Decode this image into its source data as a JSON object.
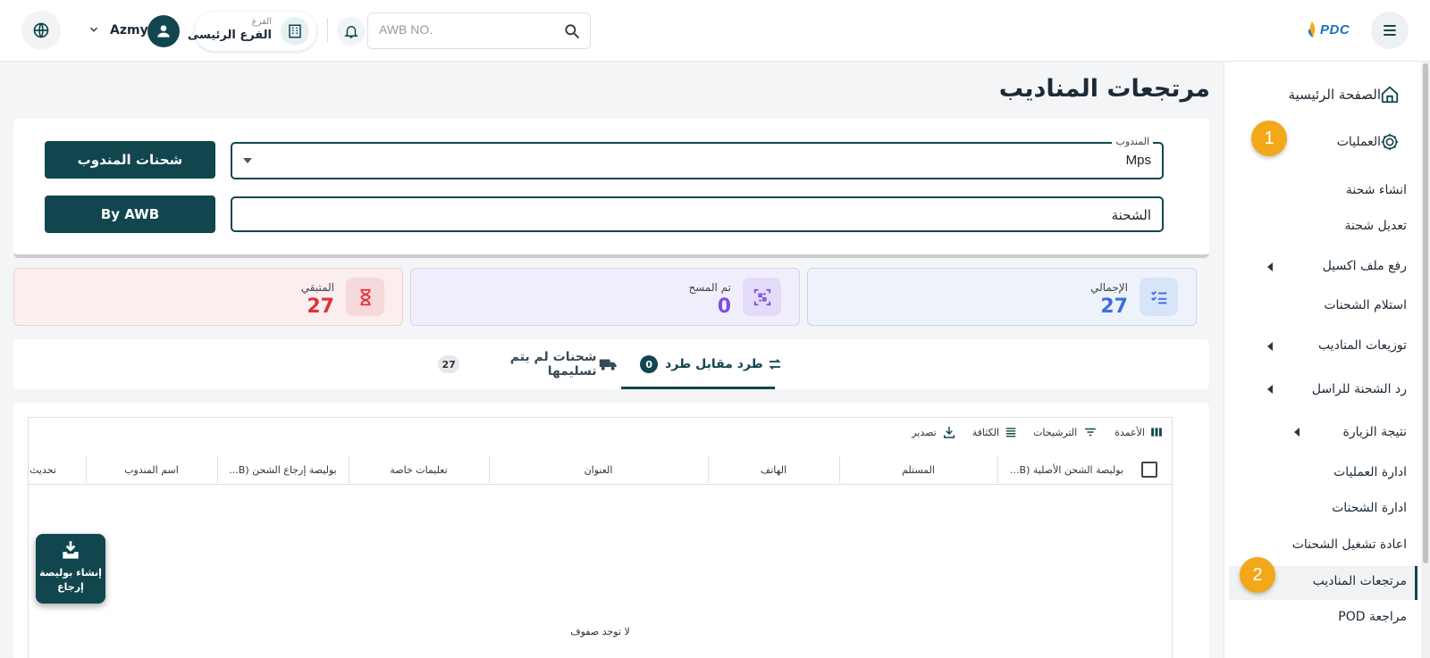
{
  "header": {
    "user_name": "Azmy",
    "branch_small": "الفرع",
    "branch_name": "الفرع الرئيسى",
    "awb_placeholder": "AWB NO.",
    "logo_text": "PDC"
  },
  "sidebar": {
    "home": "الصفحة الرئيسية",
    "operations": "العمليات",
    "items": [
      "انشاء شحنة",
      "تعديل شحنة",
      "رفع ملف اكسيل",
      "استلام الشحنات",
      "توزيعات المناديب",
      "رد الشحنة للراسل",
      "نتيجة الزيارة",
      "ادارة العمليات",
      "ادارة الشحنات",
      "اعادة تشغيل الشحنات",
      "مرتجعات المناديب",
      "مراجعة POD"
    ],
    "badge1": "1",
    "badge2": "2"
  },
  "page": {
    "title": "مرتجعات المناديب"
  },
  "filter": {
    "rep_label": "المندوب",
    "rep_value": "Mps",
    "shipment_value": "الشحنة",
    "rep_shipments_btn": "شحنات المندوب",
    "by_awb_btn": "By AWB"
  },
  "stats": {
    "total_label": "الإجمالي",
    "total_value": "27",
    "scanned_label": "تم المسح",
    "scanned_value": "0",
    "remaining_label": "المتبقي",
    "remaining_value": "27",
    "colors": {
      "total": "#3b6fe0",
      "scanned": "#7b4fe0",
      "remaining": "#e0323c"
    }
  },
  "tabs": [
    {
      "label": "طرد مقابل طرد",
      "count": "0"
    },
    {
      "label": "شحنات لم يتم تسليمها",
      "count": "27"
    }
  ],
  "grid": {
    "toolbar": {
      "columns": "الأعمدة",
      "filters": "الترشيحات",
      "density": "الكثافة",
      "export": "تصدير"
    },
    "columns": [
      "بوليصة الشحن الأصلية (B...",
      "المستلم",
      "الهاتف",
      "العنوان",
      "تعليمات خاصة",
      "بوليصة إرجاع الشحن (B...",
      "اسم المندوب",
      "تحديث"
    ],
    "no_rows": "لا توجد صفوف"
  },
  "fab": {
    "label": "إنشاء بوليصة إرجاع"
  }
}
